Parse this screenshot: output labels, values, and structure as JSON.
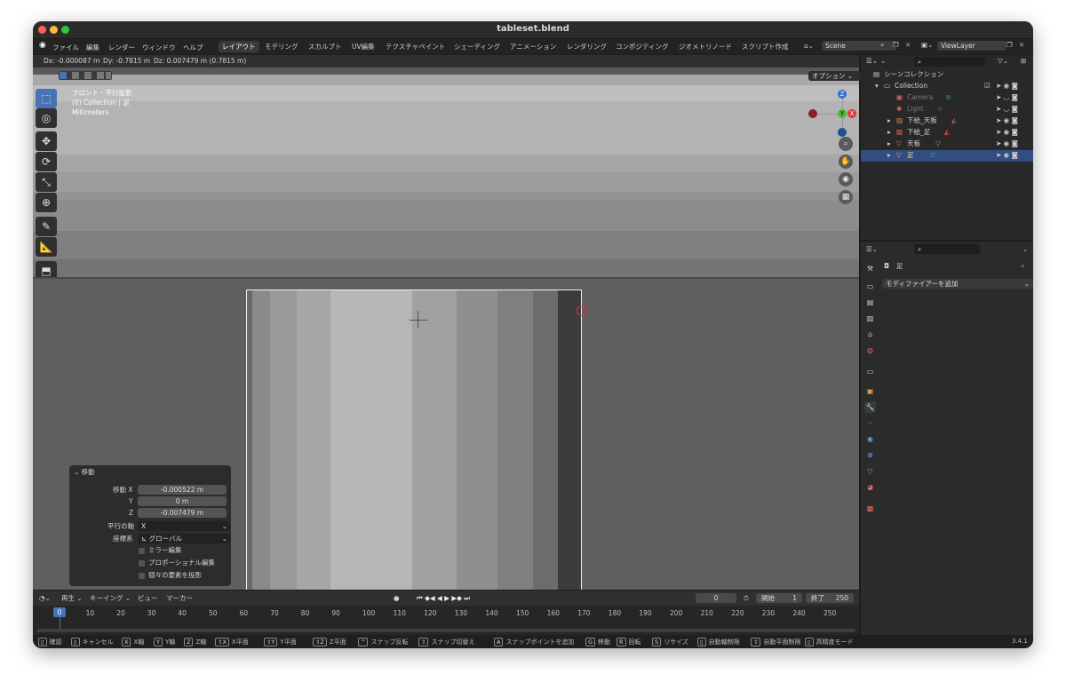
{
  "window": {
    "title": "tableset.blend"
  },
  "menu": [
    "ファイル",
    "編集",
    "レンダー",
    "ウィンドウ",
    "ヘルプ"
  ],
  "workspaces": [
    {
      "label": "レイアウト",
      "active": true
    },
    {
      "label": "モデリング"
    },
    {
      "label": "スカルプト"
    },
    {
      "label": "UV編集"
    },
    {
      "label": "テクスチャペイント"
    },
    {
      "label": "シェーディング"
    },
    {
      "label": "アニメーション"
    },
    {
      "label": "レンダリング"
    },
    {
      "label": "コンポジティング"
    },
    {
      "label": "ジオメトリノード"
    },
    {
      "label": "スクリプト作成"
    }
  ],
  "scene": {
    "name": "Scene"
  },
  "viewlayer": {
    "name": "ViewLayer"
  },
  "header_readout": {
    "dx": "Dx: -0.000087 m",
    "dy": "Dy: -0.7815 m",
    "dz": "Dz: 0.007479 m (0.7815 m)"
  },
  "viewport": {
    "overlay_line1": "フロント・平行投影",
    "overlay_line2": "(0) Collection | 足",
    "overlay_line3": "Millimeters",
    "options_label": "オプション"
  },
  "gizmo": {
    "z": "Z",
    "y": "Y",
    "x": "X"
  },
  "operator_panel": {
    "title": "移動",
    "move_x_label": "移動 X",
    "move_x": "-0.000522 m",
    "y_label": "Y",
    "y": "0 m",
    "z_label": "Z",
    "z": "-0.007479 m",
    "axis_label": "平行の軸",
    "axis": "X",
    "orient_label": "座標系",
    "orient": "グローバル",
    "mirror": "ミラー編集",
    "proportional": "プロポーショナル編集",
    "individual": "個々の要素を投影"
  },
  "outliner": {
    "scene_collection": "シーンコレクション",
    "collection": "Collection",
    "items": [
      {
        "name": "Camera",
        "dim": true
      },
      {
        "name": "Light",
        "dim": true
      },
      {
        "name": "下絵_天板"
      },
      {
        "name": "下絵_足"
      },
      {
        "name": "天板"
      },
      {
        "name": "足",
        "selected": true
      }
    ]
  },
  "properties": {
    "object_name": "足",
    "add_modifier": "モディファイアーを追加"
  },
  "timeline": {
    "play_label": "再生",
    "keying_label": "キーイング",
    "view_label": "ビュー",
    "marker_label": "マーカー",
    "current_frame": "0",
    "start_label": "開始",
    "start": "1",
    "end_label": "終了",
    "end": "250",
    "frame_marker": "0",
    "ticks": [
      "10",
      "20",
      "30",
      "40",
      "50",
      "60",
      "70",
      "80",
      "90",
      "100",
      "110",
      "120",
      "130",
      "140",
      "150",
      "160",
      "170",
      "180",
      "190",
      "200",
      "210",
      "220",
      "230",
      "240",
      "250"
    ]
  },
  "statusbar": {
    "items": [
      {
        "key": "",
        "label": "確認"
      },
      {
        "key": "",
        "label": "キャンセル"
      },
      {
        "key": "X",
        "label": "X軸"
      },
      {
        "key": "Y",
        "label": "Y軸"
      },
      {
        "key": "Z",
        "label": "Z軸"
      },
      {
        "key": "⇧X",
        "label": "X平面"
      },
      {
        "key": "⇧Y",
        "label": "Y平面"
      },
      {
        "key": "⇧Z",
        "label": "Z平面"
      },
      {
        "key": "^",
        "label": "スナップ反転"
      },
      {
        "key": "⇧",
        "label": "スナップ切替え"
      },
      {
        "key": "A",
        "label": "スナップポイントを追加"
      },
      {
        "key": "G",
        "label": "移動"
      },
      {
        "key": "R",
        "label": "回転"
      },
      {
        "key": "S",
        "label": "リサイズ"
      },
      {
        "key": "",
        "label": "自動軸制限"
      },
      {
        "key": "⇧",
        "label": "自動平面制限"
      },
      {
        "key": "",
        "label": "高精度モード"
      }
    ],
    "version": "3.4.1"
  }
}
